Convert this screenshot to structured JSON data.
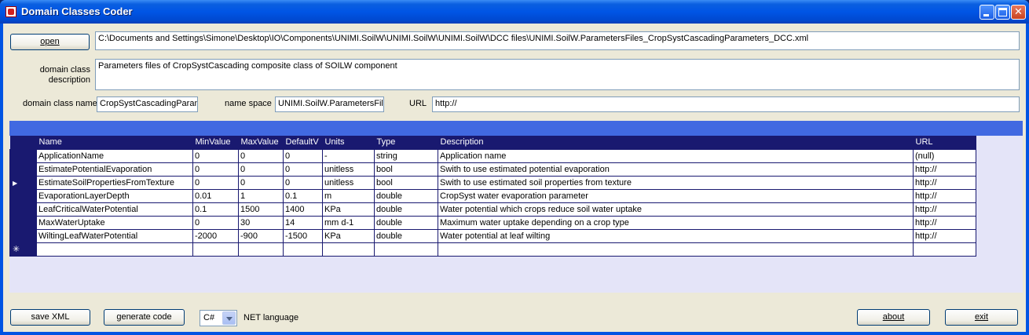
{
  "window": {
    "title": "Domain Classes Coder"
  },
  "file": {
    "open_label": "open",
    "path": "C:\\Documents and Settings\\Simone\\Desktop\\IO\\Components\\UNIMI.SoilW\\UNIMI.SoilW\\UNIMI.SoilW\\DCC files\\UNIMI.SoilW.ParametersFiles_CropSystCascadingParameters_DCC.xml"
  },
  "description": {
    "label": "domain class description",
    "value": "Parameters files of CropSystCascading composite class of SOILW component"
  },
  "class_info": {
    "name_label": "domain class name",
    "name_value": "CropSystCascadingParam",
    "namespace_label": "name space",
    "namespace_value": "UNIMI.SoilW.ParametersFil",
    "url_label": "URL",
    "url_value": "http://"
  },
  "grid": {
    "columns": [
      "Name",
      "MinValue",
      "MaxValue",
      "DefaultV",
      "Units",
      "Type",
      "Description",
      "URL"
    ],
    "rows": [
      [
        "ApplicationName",
        "0",
        "0",
        "0",
        "-",
        "string",
        "Application name",
        "(null)"
      ],
      [
        "EstimatePotentialEvaporation",
        "0",
        "0",
        "0",
        "unitless",
        "bool",
        "Swith to use estimated potential evaporation",
        "http://"
      ],
      [
        "EstimateSoilPropertiesFromTexture",
        "0",
        "0",
        "0",
        "unitless",
        "bool",
        "Swith to use estimated soil properties from texture",
        "http://"
      ],
      [
        "EvaporationLayerDepth",
        "0.01",
        "1",
        "0.1",
        "m",
        "double",
        "CropSyst water evaporation parameter",
        "http://"
      ],
      [
        "LeafCriticalWaterPotential",
        "0.1",
        "1500",
        "1400",
        "KPa",
        "double",
        "Water potential which crops reduce soil water uptake",
        "http://"
      ],
      [
        "MaxWaterUptake",
        "0",
        "30",
        "14",
        "mm d-1",
        "double",
        "Maximum water uptake depending on a crop type",
        "http://"
      ],
      [
        "WiltingLeafWaterPotential",
        "-2000",
        "-900",
        "-1500",
        "KPa",
        "double",
        "Water potential at leaf wilting",
        "http://"
      ]
    ],
    "current_row_glyph": "▶",
    "new_row_glyph": "✳"
  },
  "footer": {
    "save_label": "save XML",
    "generate_label": "generate code",
    "language_value": "C#",
    "language_label": "NET language",
    "about_label": "about",
    "exit_label": "exit"
  },
  "colors": {
    "grid_header": "#191970",
    "grid_caption": "#4169e1",
    "grid_background": "#e4e4f8"
  }
}
